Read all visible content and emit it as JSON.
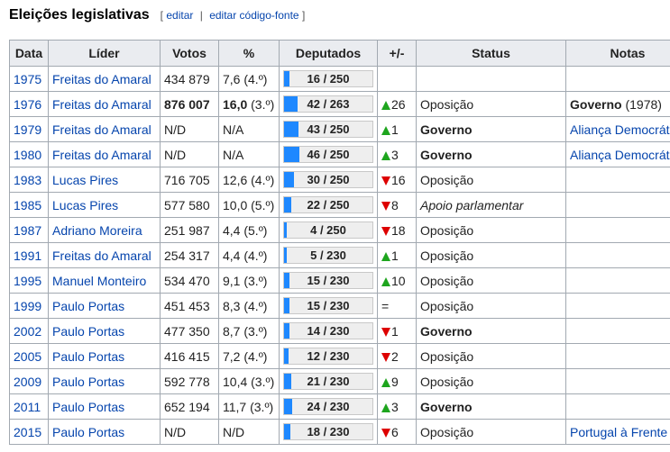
{
  "heading": {
    "title": "Eleições legislativas",
    "bracket_open": "[",
    "edit": "editar",
    "sep": "|",
    "edit_source": "editar código-fonte",
    "bracket_close": "]"
  },
  "table": {
    "headers": [
      "Data",
      "Líder",
      "Votos",
      "%",
      "Deputados",
      "+/-",
      "Status",
      "Notas"
    ],
    "rows": [
      {
        "year": "1975",
        "leader": "Freitas do Amaral",
        "votes": "434 879",
        "pct": "7,6",
        "rank": "(4.º)",
        "seats": "16 / 250",
        "seat_fraction": 0.064,
        "change_dir": "",
        "change": "",
        "status": "",
        "notes": "",
        "notes_suffix": ""
      },
      {
        "year": "1976",
        "leader": "Freitas do Amaral",
        "votes": "876 007",
        "pct": "16,0",
        "rank": "(3.º)",
        "seats": "42 / 263",
        "seat_fraction": 0.16,
        "change_dir": "up",
        "change": "26",
        "status": "Oposição",
        "notes": "Governo",
        "notes_suffix": " (1978)"
      },
      {
        "year": "1979",
        "leader": "Freitas do Amaral",
        "votes": "N/D",
        "pct": "N/A",
        "rank": "",
        "seats": "43 / 250",
        "seat_fraction": 0.172,
        "change_dir": "up",
        "change": "1",
        "status": "Governo",
        "notes": "Aliança Democrática",
        "notes_suffix": ""
      },
      {
        "year": "1980",
        "leader": "Freitas do Amaral",
        "votes": "N/D",
        "pct": "N/A",
        "rank": "",
        "seats": "46 / 250",
        "seat_fraction": 0.184,
        "change_dir": "up",
        "change": "3",
        "status": "Governo",
        "notes": "Aliança Democrática",
        "notes_suffix": ""
      },
      {
        "year": "1983",
        "leader": "Lucas Pires",
        "votes": "716 705",
        "pct": "12,6",
        "rank": "(4.º)",
        "seats": "30 / 250",
        "seat_fraction": 0.12,
        "change_dir": "down",
        "change": "16",
        "status": "Oposição",
        "notes": "",
        "notes_suffix": ""
      },
      {
        "year": "1985",
        "leader": "Lucas Pires",
        "votes": "577 580",
        "pct": "10,0",
        "rank": "(5.º)",
        "seats": "22 / 250",
        "seat_fraction": 0.088,
        "change_dir": "down",
        "change": "8",
        "status": "Apoio parlamentar",
        "notes": "",
        "notes_suffix": ""
      },
      {
        "year": "1987",
        "leader": "Adriano Moreira",
        "votes": "251 987",
        "pct": "4,4",
        "rank": "(5.º)",
        "seats": "4 / 250",
        "seat_fraction": 0.016,
        "change_dir": "down",
        "change": "18",
        "status": "Oposição",
        "notes": "",
        "notes_suffix": ""
      },
      {
        "year": "1991",
        "leader": "Freitas do Amaral",
        "votes": "254 317",
        "pct": "4,4",
        "rank": "(4.º)",
        "seats": "5 / 230",
        "seat_fraction": 0.022,
        "change_dir": "up",
        "change": "1",
        "status": "Oposição",
        "notes": "",
        "notes_suffix": ""
      },
      {
        "year": "1995",
        "leader": "Manuel Monteiro",
        "votes": "534 470",
        "pct": "9,1",
        "rank": "(3.º)",
        "seats": "15 / 230",
        "seat_fraction": 0.065,
        "change_dir": "up",
        "change": "10",
        "status": "Oposição",
        "notes": "",
        "notes_suffix": ""
      },
      {
        "year": "1999",
        "leader": "Paulo Portas",
        "votes": "451 453",
        "pct": "8,3",
        "rank": "(4.º)",
        "seats": "15 / 230",
        "seat_fraction": 0.065,
        "change_dir": "eq",
        "change": "=",
        "status": "Oposição",
        "notes": "",
        "notes_suffix": ""
      },
      {
        "year": "2002",
        "leader": "Paulo Portas",
        "votes": "477 350",
        "pct": "8,7",
        "rank": "(3.º)",
        "seats": "14 / 230",
        "seat_fraction": 0.061,
        "change_dir": "down",
        "change": "1",
        "status": "Governo",
        "notes": "",
        "notes_suffix": ""
      },
      {
        "year": "2005",
        "leader": "Paulo Portas",
        "votes": "416 415",
        "pct": "7,2",
        "rank": "(4.º)",
        "seats": "12 / 230",
        "seat_fraction": 0.052,
        "change_dir": "down",
        "change": "2",
        "status": "Oposição",
        "notes": "",
        "notes_suffix": ""
      },
      {
        "year": "2009",
        "leader": "Paulo Portas",
        "votes": "592 778",
        "pct": "10,4",
        "rank": "(3.º)",
        "seats": "21 / 230",
        "seat_fraction": 0.091,
        "change_dir": "up",
        "change": "9",
        "status": "Oposição",
        "notes": "",
        "notes_suffix": ""
      },
      {
        "year": "2011",
        "leader": "Paulo Portas",
        "votes": "652 194",
        "pct": "11,7",
        "rank": "(3.º)",
        "seats": "24 / 230",
        "seat_fraction": 0.104,
        "change_dir": "up",
        "change": "3",
        "status": "Governo",
        "notes": "",
        "notes_suffix": ""
      },
      {
        "year": "2015",
        "leader": "Paulo Portas",
        "votes": "N/D",
        "pct": "N/D",
        "rank": "",
        "seats": "18 / 230",
        "seat_fraction": 0.078,
        "change_dir": "down",
        "change": "6",
        "status": "Oposição",
        "notes": "Portugal à Frente",
        "notes_suffix": ""
      }
    ]
  },
  "colors": {
    "link": "#0645ad",
    "bar_fill": "#1e88ff",
    "up": "#1ea51e",
    "down": "#d00"
  }
}
